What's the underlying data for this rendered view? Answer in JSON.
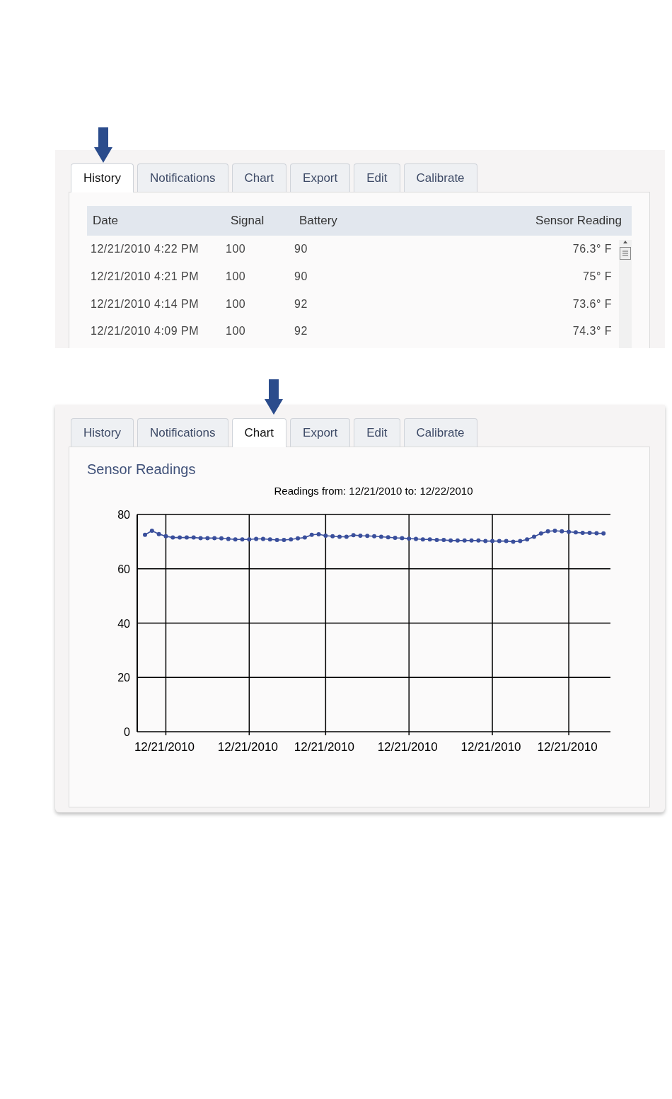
{
  "history_panel": {
    "tabs": [
      {
        "label": "History",
        "selected": true
      },
      {
        "label": "Notifications",
        "selected": false
      },
      {
        "label": "Chart",
        "selected": false
      },
      {
        "label": "Export",
        "selected": false
      },
      {
        "label": "Edit",
        "selected": false
      },
      {
        "label": "Calibrate",
        "selected": false
      }
    ],
    "table": {
      "columns": [
        "Date",
        "Signal",
        "Battery",
        "Sensor Reading"
      ],
      "rows": [
        [
          "12/21/2010 4:22 PM",
          "100",
          "90",
          "76.3° F"
        ],
        [
          "12/21/2010 4:21 PM",
          "100",
          "90",
          "75° F"
        ],
        [
          "12/21/2010 4:14 PM",
          "100",
          "92",
          "73.6° F"
        ],
        [
          "12/21/2010 4:09 PM",
          "100",
          "92",
          "74.3° F"
        ]
      ]
    }
  },
  "chart_panel": {
    "tabs": [
      {
        "label": "History",
        "selected": false
      },
      {
        "label": "Notifications",
        "selected": false
      },
      {
        "label": "Chart",
        "selected": true
      },
      {
        "label": "Export",
        "selected": false
      },
      {
        "label": "Edit",
        "selected": false
      },
      {
        "label": "Calibrate",
        "selected": false
      }
    ],
    "heading": "Sensor Readings",
    "chart_data": {
      "type": "line",
      "title": "Readings from: 12/21/2010 to: 12/22/2010",
      "ylim": [
        0,
        80
      ],
      "yticks": [
        0,
        20,
        40,
        60,
        80
      ],
      "grid": true,
      "categories": [
        null,
        null,
        null,
        "12/21/2010",
        null,
        null,
        null,
        null,
        null,
        null,
        null,
        null,
        null,
        null,
        null,
        "12/21/2010",
        null,
        null,
        null,
        null,
        null,
        null,
        null,
        null,
        null,
        null,
        "12/21/2010",
        null,
        null,
        null,
        null,
        null,
        null,
        null,
        null,
        null,
        null,
        null,
        "12/21/2010",
        null,
        null,
        null,
        null,
        null,
        null,
        null,
        null,
        null,
        null,
        null,
        "12/21/2010",
        null,
        null,
        null,
        null,
        null,
        null,
        null,
        null,
        null,
        null,
        "12/21/2010",
        null,
        null,
        null,
        null,
        null
      ],
      "series": [
        {
          "color": "#3a4f9c",
          "marker": "circle",
          "values": [
            72.5,
            74,
            72.8,
            72,
            71.5,
            71.5,
            71.5,
            71.5,
            71.3,
            71.3,
            71.3,
            71.2,
            71,
            70.8,
            70.8,
            70.8,
            71,
            71,
            70.8,
            70.6,
            70.6,
            70.8,
            71.2,
            71.5,
            72.5,
            72.7,
            72.2,
            72,
            71.8,
            71.8,
            72.4,
            72.2,
            72.1,
            72,
            71.8,
            71.6,
            71.4,
            71.3,
            71.1,
            71,
            70.8,
            70.8,
            70.6,
            70.6,
            70.4,
            70.4,
            70.4,
            70.4,
            70.4,
            70.2,
            70.2,
            70.2,
            70.2,
            70,
            70.2,
            70.8,
            71.8,
            73,
            73.8,
            74,
            73.8,
            73.6,
            73.4,
            73.2,
            73.2,
            73.1,
            73
          ]
        }
      ]
    }
  }
}
